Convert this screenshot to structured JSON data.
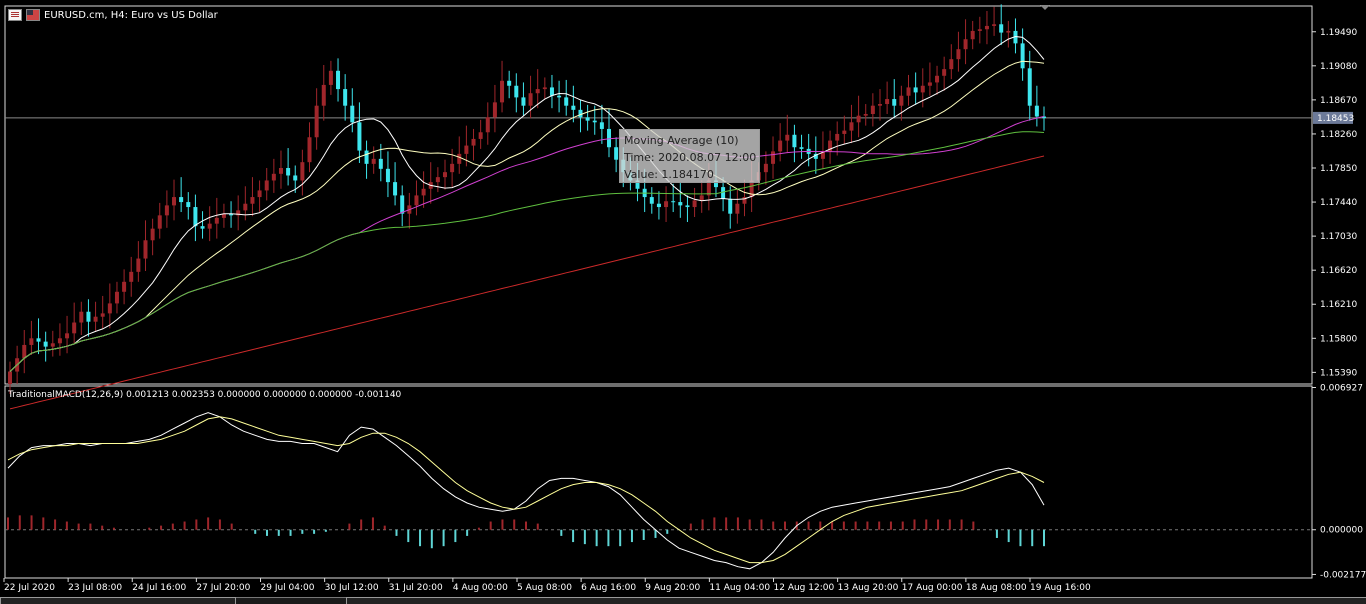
{
  "window": {
    "title": "EURUSD.cm, H4:  Euro vs US Dollar",
    "flag_icons": [
      "eu-flag-icon",
      "us-flag-icon"
    ]
  },
  "tooltip": {
    "line1": "Moving Average (10)",
    "line2": "Time: 2020.08.07 12:00",
    "line3": "Value: 1.184170"
  },
  "colors": {
    "bull": "#a0262b",
    "bear": "#3ee6ee",
    "ma10": "#ffffff",
    "ma20": "#ffffc0",
    "ma50": "#d040d0",
    "ma100": "#5fbf3f",
    "ma200": "#cc2a2a",
    "hist_pos": "#a0262b",
    "hist_neg": "#5fd6d6",
    "macd_line": "#ffffff",
    "signal_line": "#ffff99",
    "grid": "#8a8a8a",
    "price_badge": "#6c7a99"
  },
  "chart_data": [
    {
      "type": "candlestick",
      "symbol": "EURUSD.cm",
      "timeframe": "H4",
      "ylim": [
        1.1525,
        1.198
      ],
      "y_ticks": [
        "1.19490",
        "1.19080",
        "1.18670",
        "1.18260",
        "1.17850",
        "1.17440",
        "1.17030",
        "1.16620",
        "1.16210",
        "1.15800",
        "1.15390"
      ],
      "current_price": "1.18453",
      "x_ticks": [
        "22 Jul 2020",
        "23 Jul 08:00",
        "24 Jul 16:00",
        "27 Jul 20:00",
        "29 Jul 04:00",
        "30 Jul 12:00",
        "31 Jul 20:00",
        "4 Aug 00:00",
        "5 Aug 08:00",
        "6 Aug 16:00",
        "9 Aug 20:00",
        "11 Aug 04:00",
        "12 Aug 12:00",
        "13 Aug 20:00",
        "17 Aug 00:00",
        "18 Aug 08:00",
        "19 Aug 16:00"
      ],
      "closes": [
        1.154,
        1.1556,
        1.1572,
        1.158,
        1.1576,
        1.157,
        1.1574,
        1.158,
        1.1586,
        1.1599,
        1.1612,
        1.16,
        1.1606,
        1.161,
        1.1622,
        1.1636,
        1.1648,
        1.166,
        1.1676,
        1.1698,
        1.1712,
        1.1728,
        1.174,
        1.175,
        1.1744,
        1.1738,
        1.1715,
        1.1712,
        1.1718,
        1.1725,
        1.173,
        1.1728,
        1.1734,
        1.1742,
        1.175,
        1.1758,
        1.177,
        1.1778,
        1.1785,
        1.1776,
        1.177,
        1.1792,
        1.1822,
        1.186,
        1.1885,
        1.1902,
        1.188,
        1.186,
        1.184,
        1.1806,
        1.179,
        1.1796,
        1.1784,
        1.1768,
        1.1752,
        1.173,
        1.174,
        1.1752,
        1.176,
        1.1768,
        1.1774,
        1.178,
        1.179,
        1.1802,
        1.1812,
        1.182,
        1.1828,
        1.1846,
        1.1864,
        1.189,
        1.1884,
        1.187,
        1.186,
        1.1875,
        1.188,
        1.1882,
        1.1872,
        1.187,
        1.186,
        1.1855,
        1.1846,
        1.1842,
        1.184,
        1.1832,
        1.181,
        1.1795,
        1.178,
        1.177,
        1.176,
        1.175,
        1.1742,
        1.1738,
        1.1745,
        1.1744,
        1.174,
        1.1738,
        1.1746,
        1.1752,
        1.177,
        1.1762,
        1.1748,
        1.173,
        1.1742,
        1.175,
        1.177,
        1.178,
        1.179,
        1.1805,
        1.1818,
        1.1825,
        1.181,
        1.1808,
        1.1802,
        1.1796,
        1.1805,
        1.1818,
        1.1826,
        1.183,
        1.184,
        1.1848,
        1.185,
        1.186,
        1.1862,
        1.1868,
        1.186,
        1.1872,
        1.1882,
        1.1876,
        1.1884,
        1.1888,
        1.1896,
        1.1904,
        1.1916,
        1.1928,
        1.194,
        1.195,
        1.1952,
        1.1956,
        1.1958,
        1.1948,
        1.195,
        1.1935,
        1.1905,
        1.186,
        1.1847,
        1.1845
      ],
      "macd": {
        "label": "TraditionalMACD(12,26,9) 0.001213 0.002353 0.000000 0.000000 0.000000 -0.001140",
        "ylim": [
          -0.00235,
          0.007
        ],
        "y_ticks": [
          "0.006927",
          "0.000000",
          "-0.002177"
        ],
        "macd_line": [
          0.003,
          0.0036,
          0.004,
          0.0041,
          0.0041,
          0.0042,
          0.0042,
          0.0041,
          0.0042,
          0.0042,
          0.0042,
          0.0043,
          0.0044,
          0.0046,
          0.0049,
          0.0052,
          0.0055,
          0.0057,
          0.0055,
          0.0051,
          0.0048,
          0.0046,
          0.0044,
          0.0043,
          0.0043,
          0.0042,
          0.0042,
          0.004,
          0.0038,
          0.0046,
          0.005,
          0.0049,
          0.0045,
          0.0041,
          0.0036,
          0.0031,
          0.0025,
          0.002,
          0.0016,
          0.0013,
          0.0011,
          0.001,
          0.0009,
          0.001,
          0.0014,
          0.002,
          0.0024,
          0.0025,
          0.0025,
          0.0024,
          0.0023,
          0.0021,
          0.0017,
          0.0011,
          0.0005,
          0.0,
          -0.0005,
          -0.0009,
          -0.0011,
          -0.0013,
          -0.0015,
          -0.0016,
          -0.0018,
          -0.0019,
          -0.0016,
          -0.0011,
          -0.0004,
          0.0002,
          0.0006,
          0.0009,
          0.0011,
          0.0012,
          0.0013,
          0.0014,
          0.0015,
          0.0016,
          0.0017,
          0.0018,
          0.0019,
          0.002,
          0.0021,
          0.0023,
          0.0025,
          0.0027,
          0.0029,
          0.003,
          0.0028,
          0.0022,
          0.0012
        ],
        "signal_line": [
          0.0034,
          0.0037,
          0.0039,
          0.004,
          0.0041,
          0.0041,
          0.0042,
          0.0042,
          0.0042,
          0.0042,
          0.0042,
          0.0042,
          0.0043,
          0.0044,
          0.0046,
          0.0048,
          0.0051,
          0.0054,
          0.0055,
          0.0054,
          0.0052,
          0.005,
          0.0048,
          0.0046,
          0.0045,
          0.0044,
          0.0043,
          0.0042,
          0.0041,
          0.0042,
          0.0045,
          0.0047,
          0.0047,
          0.0045,
          0.0042,
          0.0038,
          0.0033,
          0.0028,
          0.0023,
          0.0019,
          0.0016,
          0.0013,
          0.0011,
          0.001,
          0.0011,
          0.0014,
          0.0017,
          0.002,
          0.0022,
          0.0023,
          0.0023,
          0.0022,
          0.002,
          0.0017,
          0.0013,
          0.0009,
          0.0004,
          0.0,
          -0.0004,
          -0.0007,
          -0.001,
          -0.0012,
          -0.0014,
          -0.0016,
          -0.0016,
          -0.0015,
          -0.0012,
          -0.0008,
          -0.0004,
          0.0,
          0.0004,
          0.0007,
          0.0009,
          0.0011,
          0.0012,
          0.0013,
          0.0014,
          0.0015,
          0.0016,
          0.0017,
          0.0018,
          0.0019,
          0.0021,
          0.0023,
          0.0025,
          0.0027,
          0.0028,
          0.0026,
          0.0023
        ],
        "histogram": [
          0.0006,
          0.0007,
          0.0007,
          0.0006,
          0.0005,
          0.0004,
          0.0003,
          0.0003,
          0.0002,
          0.0001,
          0.0,
          0.0,
          0.0001,
          0.0002,
          0.0003,
          0.0004,
          0.0005,
          0.0006,
          0.0005,
          0.0003,
          0.0,
          -0.0002,
          -0.0003,
          -0.0003,
          -0.0003,
          -0.0002,
          -0.0002,
          -0.0001,
          0.0,
          0.0003,
          0.0005,
          0.0006,
          0.0002,
          -0.0003,
          -0.0006,
          -0.0008,
          -0.0009,
          -0.0008,
          -0.0006,
          -0.0003,
          0.0001,
          0.0004,
          0.0005,
          0.0005,
          0.0004,
          0.0003,
          0.0,
          -0.0003,
          -0.0006,
          -0.0007,
          -0.0008,
          -0.0008,
          -0.0008,
          -0.0006,
          -0.0005,
          -0.0004,
          -0.0002,
          0.0,
          0.0003,
          0.0005,
          0.0006,
          0.0006,
          0.0006,
          0.0005,
          0.0005,
          0.0004,
          0.0004,
          0.0004,
          0.0004,
          0.0004,
          0.0004,
          0.0004,
          0.0004,
          0.0004,
          0.0004,
          0.0004,
          0.0004,
          0.0005,
          0.0005,
          0.0005,
          0.0005,
          0.0005,
          0.0004,
          0.0,
          -0.0004,
          -0.0006,
          -0.0008,
          -0.0008,
          -0.0008
        ]
      }
    }
  ]
}
